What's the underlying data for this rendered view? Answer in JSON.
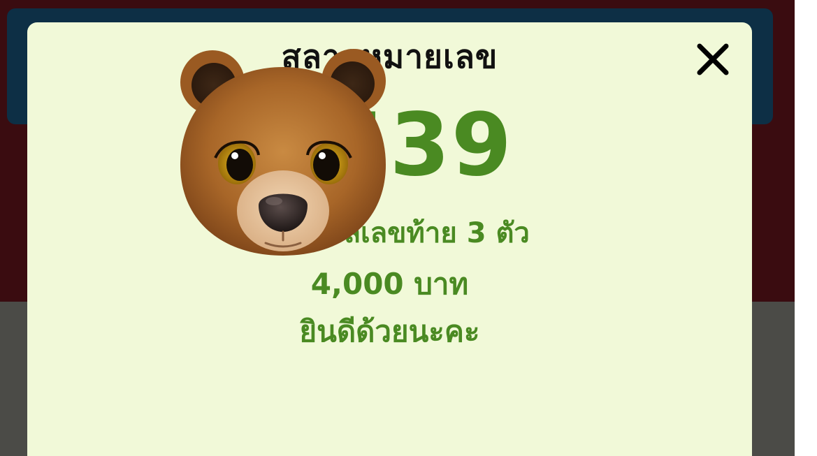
{
  "modal": {
    "title": "สลากหมายเลข",
    "number": "1439",
    "prize_text": "ถูกรางวัลเลขท้าย 3 ตัว",
    "amount_text": "4,000 บาท",
    "congrats_text": "ยินดีด้วยนะคะ",
    "close_icon": "close-icon"
  },
  "overlay": {
    "sticker": "bear-memoji-sticker"
  },
  "colors": {
    "modal_background": "#f1f9d8",
    "accent_green": "#4a8a22",
    "header_navy": "#0d2f45",
    "page_maroon": "#3a0c10",
    "page_gray": "#4b4b47"
  }
}
